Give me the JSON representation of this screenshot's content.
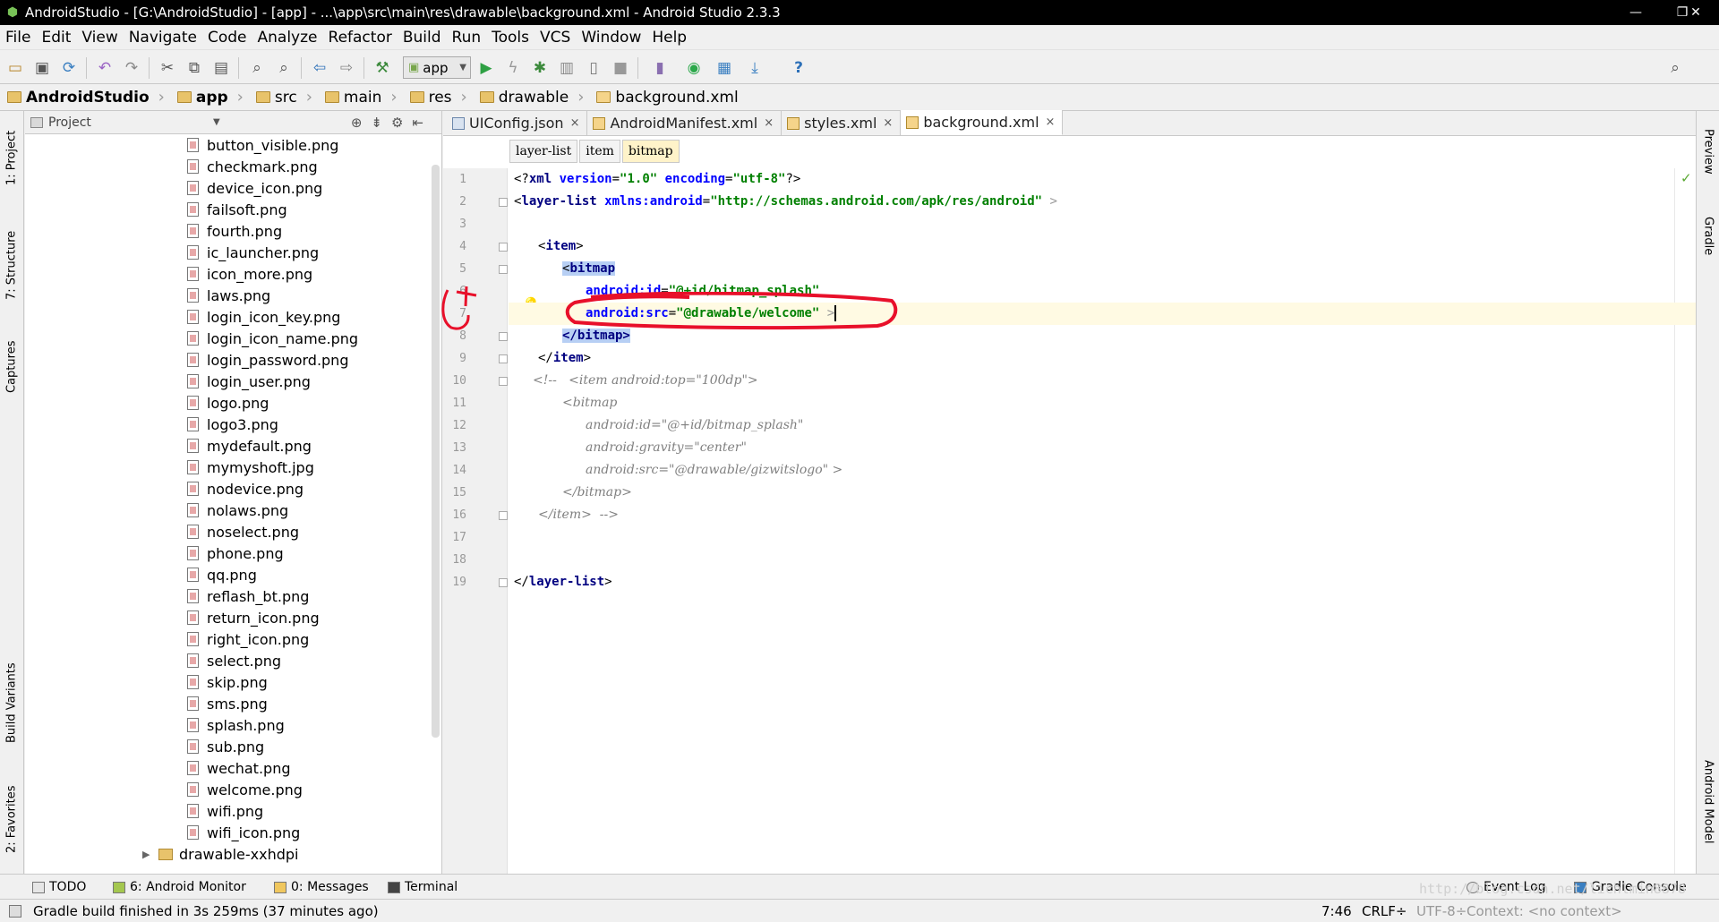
{
  "window": {
    "title": "AndroidStudio - [G:\\AndroidStudio] - [app] - ...\\app\\src\\main\\res\\drawable\\background.xml - Android Studio 2.3.3",
    "controls": [
      "—",
      "❐",
      "✕"
    ]
  },
  "menu": [
    "File",
    "Edit",
    "View",
    "Navigate",
    "Code",
    "Analyze",
    "Refactor",
    "Build",
    "Run",
    "Tools",
    "VCS",
    "Window",
    "Help"
  ],
  "toolbar": {
    "run_config": "app",
    "icons": [
      "open-icon",
      "save-all-icon",
      "sync-icon",
      "undo-icon",
      "redo-icon",
      "cut-icon",
      "copy-icon",
      "paste-icon",
      "find-icon",
      "replace-icon",
      "back-icon",
      "forward-icon",
      "make-icon",
      "run-icon",
      "apply-changes-icon",
      "debug-icon",
      "profile-icon",
      "attach-debugger-icon",
      "stop-icon",
      "avd-manager-icon",
      "sync-gradle-icon",
      "project-structure-icon",
      "sdk-manager-icon",
      "help-icon",
      "search-everywhere-icon"
    ]
  },
  "breadcrumbs": [
    "AndroidStudio",
    "app",
    "src",
    "main",
    "res",
    "drawable",
    "background.xml"
  ],
  "left_tool_tabs": [
    "1: Project",
    "7: Structure",
    "Captures",
    "Build Variants",
    "2: Favorites"
  ],
  "right_tool_tabs": [
    "Preview",
    "Gradle",
    "Android Model"
  ],
  "project_panel": {
    "view_mode": "Project",
    "files": [
      "button_visible.png",
      "checkmark.png",
      "device_icon.png",
      "failsoft.png",
      "fourth.png",
      "ic_launcher.png",
      "icon_more.png",
      "laws.png",
      "login_icon_key.png",
      "login_icon_name.png",
      "login_password.png",
      "login_user.png",
      "logo.png",
      "logo3.png",
      "mydefault.png",
      "mymyshoft.jpg",
      "nodevice.png",
      "nolaws.png",
      "noselect.png",
      "phone.png",
      "qq.png",
      "reflash_bt.png",
      "return_icon.png",
      "right_icon.png",
      "select.png",
      "skip.png",
      "sms.png",
      "splash.png",
      "sub.png",
      "wechat.png",
      "welcome.png",
      "wifi.png",
      "wifi_icon.png"
    ],
    "folder": "drawable-xxhdpi"
  },
  "editor": {
    "tabs": [
      {
        "label": "UIConfig.json",
        "close": "×"
      },
      {
        "label": "AndroidManifest.xml",
        "close": "×"
      },
      {
        "label": "styles.xml",
        "close": "×"
      },
      {
        "label": "background.xml",
        "close": "×"
      }
    ],
    "active_tab": "background.xml",
    "xml_breadcrumbs": [
      "layer-list",
      "item",
      "bitmap"
    ],
    "line_numbers": [
      "1",
      "2",
      "3",
      "4",
      "5",
      "6",
      "7",
      "8",
      "9",
      "10",
      "11",
      "12",
      "13",
      "14",
      "15",
      "16",
      "17",
      "18",
      "19"
    ],
    "lines": {
      "l1_open": "<?",
      "l1_tag": "xml",
      "l1_a1": " version",
      "l1_eq1": "=",
      "l1_v1": "\"1.0\"",
      "l1_a2": " encoding",
      "l1_eq2": "=",
      "l1_v2": "\"utf-8\"",
      "l1_close": "?>",
      "l2_open": "<",
      "l2_tag": "layer-list",
      "l2_attr": " xmlns:android",
      "l2_eq": "=",
      "l2_val": "\"http://schemas.android.com/apk/res/android\"",
      "l2_close": " >",
      "l4_open": "<",
      "l4_tag": "item",
      "l4_close": ">",
      "l5_open": "<",
      "l5_tag": "bitmap",
      "l6_attr": "android:id",
      "l6_eq": "=",
      "l6_val": "\"@+id/bitmap_splash\"",
      "l7_attr": "android:src",
      "l7_eq": "=",
      "l7_val": "\"@drawable/welcome\"",
      "l7_close": " >",
      "l8_tag": "</bitmap>",
      "l9_open": "</",
      "l9_tag": "item",
      "l9_close": ">",
      "l10": "<!--   <item android:top=\"100dp\">",
      "l11": "<bitmap",
      "l12": "android:id=\"@+id/bitmap_splash\"",
      "l13": "android:gravity=\"center\"",
      "l14": "android:src=\"@drawable/gizwitslogo\" >",
      "l15": "</bitmap>",
      "l16": "</item>  -->",
      "l19_open": "</",
      "l19_tag": "layer-list",
      "l19_close": ">"
    }
  },
  "bottom_tabs": [
    "TODO",
    "6: Android Monitor",
    "0: Messages",
    "Terminal",
    "Event Log",
    "Gradle Console"
  ],
  "status": {
    "message": "Gradle build finished in 3s 259ms (37 minutes ago)",
    "position": "7:46",
    "line_sep": "CRLF÷",
    "encoding": "UTF-8÷",
    "context": "Context: <no context>"
  },
  "watermark": "http://blog.csdn.net/lichlmin8878",
  "colors": {
    "tag": "#000080",
    "attr": "#0000ff",
    "string": "#008000",
    "comment": "#808080",
    "annotation": "#e8102a",
    "highlight": "#b7cff4"
  }
}
